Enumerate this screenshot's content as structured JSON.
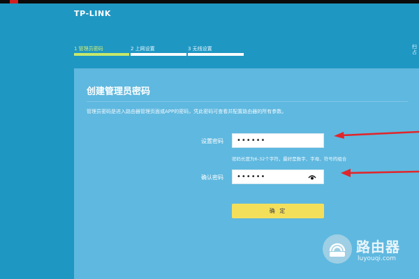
{
  "brand": {
    "logo": "TP-LINK"
  },
  "steps": [
    {
      "label": "1 管理员密码",
      "active": true
    },
    {
      "label": "2 上网设置",
      "active": false
    },
    {
      "label": "3 无线设置",
      "active": false
    }
  ],
  "right_edge": {
    "line1": "扫",
    "line2": "占"
  },
  "panel": {
    "title": "创建管理员密码",
    "description": "管理员密码是进入路由器管理页面或APP的密码，凭此密码可查看并配置路由器的所有参数。",
    "set_password": {
      "label": "设置密码",
      "value": "••••••",
      "hint": "密码长度为6-32个字符，最好是数字、字母、符号的组合"
    },
    "confirm_password": {
      "label": "确认密码",
      "value": "••••••"
    },
    "confirm_button": "确 定"
  },
  "watermark": {
    "title": "路由器",
    "url": "luyouqi.com"
  },
  "colors": {
    "background": "#1f97c3",
    "panel": "#5fb8df",
    "active_step": "#c7e86a",
    "button": "#f4df5b",
    "annotation_arrow": "#e0262b"
  }
}
